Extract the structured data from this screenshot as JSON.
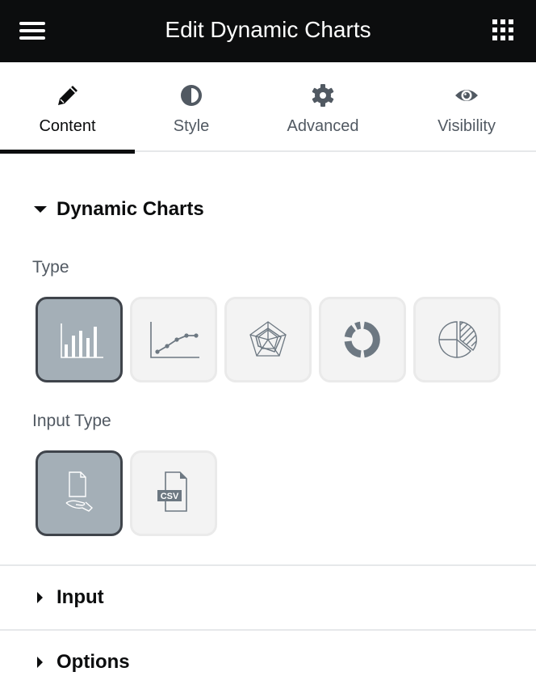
{
  "header": {
    "title": "Edit Dynamic Charts",
    "menu_icon": "hamburger-icon",
    "apps_icon": "grid-icon"
  },
  "tabs": [
    {
      "label": "Content",
      "icon": "pencil-icon",
      "active": true
    },
    {
      "label": "Style",
      "icon": "half-circle-icon",
      "active": false
    },
    {
      "label": "Advanced",
      "icon": "gear-icon",
      "active": false
    },
    {
      "label": "Visibility",
      "icon": "eye-icon",
      "active": false
    }
  ],
  "sections": {
    "dynamic_charts": {
      "title": "Dynamic Charts",
      "expanded": true,
      "type_label": "Type",
      "type_options": [
        {
          "name": "bar-chart",
          "icon": "bar-chart-icon",
          "selected": true
        },
        {
          "name": "line-chart",
          "icon": "line-chart-icon",
          "selected": false
        },
        {
          "name": "radar-chart",
          "icon": "radar-chart-icon",
          "selected": false
        },
        {
          "name": "doughnut-chart",
          "icon": "doughnut-chart-icon",
          "selected": false
        },
        {
          "name": "pie-chart",
          "icon": "pie-chart-icon",
          "selected": false
        }
      ],
      "input_type_label": "Input Type",
      "input_type_options": [
        {
          "name": "manual-input",
          "icon": "hand-file-icon",
          "selected": true
        },
        {
          "name": "csv-input",
          "icon": "csv-file-icon",
          "selected": false,
          "badge": "CSV"
        }
      ]
    },
    "input": {
      "title": "Input",
      "expanded": false
    },
    "options": {
      "title": "Options",
      "expanded": false
    }
  },
  "colors": {
    "header_bg": "#0c0d0e",
    "selected_bg": "#a4afb7",
    "selected_border": "#3f444b",
    "icon_gray": "#6d7882"
  }
}
